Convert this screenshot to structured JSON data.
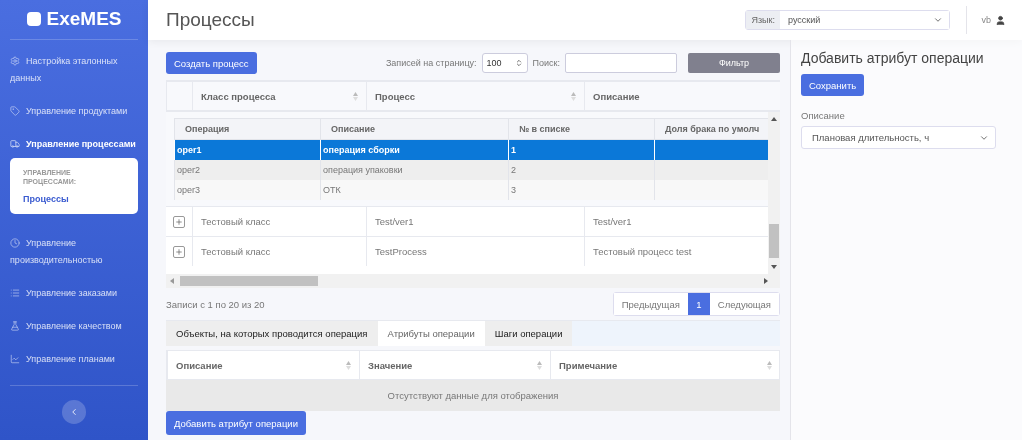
{
  "brand": {
    "name": "ExeMES"
  },
  "sidebar": {
    "items": [
      {
        "label": "Настройка эталонных данных",
        "selected": false
      },
      {
        "label": "Управление продуктами",
        "selected": false
      },
      {
        "label": "Управление процессами",
        "selected": true,
        "submenu": {
          "heading": "УПРАВЛЕНИЕ ПРОЦЕССАМИ:",
          "items": [
            {
              "label": "Процессы",
              "selected": true
            }
          ]
        }
      },
      {
        "label": "Управление производительностью",
        "selected": false
      },
      {
        "label": "Управление заказами",
        "selected": false
      },
      {
        "label": "Управление качеством",
        "selected": false
      },
      {
        "label": "Управление планами",
        "selected": false
      }
    ]
  },
  "header": {
    "title": "Процессы",
    "language": {
      "label": "Язык:",
      "value": "русский"
    },
    "user": "vb"
  },
  "toolbar": {
    "create_button": "Создать процесс",
    "page_size_label": "Записей на страницу:",
    "page_size": "100",
    "search_label": "Поиск:",
    "filter_button": "Фильтр"
  },
  "process_table": {
    "columns": [
      "Класс процесса",
      "Процесс",
      "Описание"
    ],
    "operations": {
      "columns": [
        "Операция",
        "Описание",
        "№ в списке",
        "Доля брака по умолч"
      ],
      "rows": [
        {
          "cells": [
            "oper1",
            "операция сборки",
            "1",
            ""
          ],
          "selected": true
        },
        {
          "cells": [
            "oper2",
            "операция упаковки",
            "2",
            ""
          ],
          "selected": false
        },
        {
          "cells": [
            "oper3",
            "ОТК",
            "3",
            ""
          ],
          "selected": false
        }
      ]
    },
    "rows": [
      [
        "Тестовый класс",
        "Test/ver1",
        "Test/ver1"
      ],
      [
        "Тестовый класс",
        "TestProcess",
        "Тестовый процесс test"
      ]
    ]
  },
  "pagination": {
    "info": "Записи с 1 по 20 из 20",
    "previous": "Предыдущая",
    "pages": [
      {
        "label": "1",
        "selected": true
      }
    ],
    "next": "Следующая"
  },
  "tabs": [
    {
      "label": "Объекты, на которых проводится операция",
      "selected": false
    },
    {
      "label": "Атрибуты операции",
      "selected": true
    },
    {
      "label": "Шаги операции",
      "selected": false
    }
  ],
  "attributes_table": {
    "columns": [
      "Описание",
      "Значение",
      "Примечание"
    ],
    "empty": "Отсутствуют данные для отображения"
  },
  "add_attribute_button": "Добавить атрибут операции",
  "side_panel": {
    "title": "Добавить атрибут операции",
    "save_button": "Сохранить",
    "field_label": "Описание",
    "field_value": "Плановая длительность, ч"
  }
}
